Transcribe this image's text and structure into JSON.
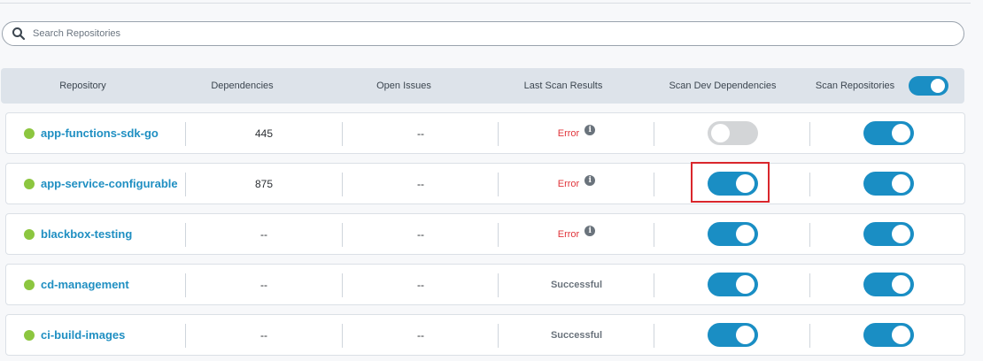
{
  "search": {
    "placeholder": "Search Repositories"
  },
  "header": {
    "repository": "Repository",
    "dependencies": "Dependencies",
    "open_issues": "Open Issues",
    "last_scan_results": "Last Scan Results",
    "scan_dev_dependencies": "Scan Dev Dependencies",
    "scan_repositories": "Scan Repositories",
    "scan_repositories_toggle": "on"
  },
  "rows": [
    {
      "name": "app-functions-sdk-go",
      "dependencies": "445",
      "open_issues": "--",
      "last_scan": "Error",
      "status": "error",
      "scan_dev": "off",
      "scan_repo": "on"
    },
    {
      "name": "app-service-configurable",
      "dependencies": "875",
      "open_issues": "--",
      "last_scan": "Error",
      "status": "error",
      "scan_dev": "on",
      "scan_repo": "on"
    },
    {
      "name": "blackbox-testing",
      "dependencies": "--",
      "open_issues": "--",
      "last_scan": "Error",
      "status": "error",
      "scan_dev": "on",
      "scan_repo": "on"
    },
    {
      "name": "cd-management",
      "dependencies": "--",
      "open_issues": "--",
      "last_scan": "Successful",
      "status": "ok",
      "scan_dev": "on",
      "scan_repo": "on"
    },
    {
      "name": "ci-build-images",
      "dependencies": "--",
      "open_issues": "--",
      "last_scan": "Successful",
      "status": "ok",
      "scan_dev": "on",
      "scan_repo": "on"
    }
  ],
  "colors": {
    "accent": "#1a8ec4",
    "error": "#e0343a",
    "active_dot": "#8cc63f",
    "highlight": "#d9262c"
  },
  "icons": {
    "search": "search-icon",
    "info": "info-icon"
  }
}
